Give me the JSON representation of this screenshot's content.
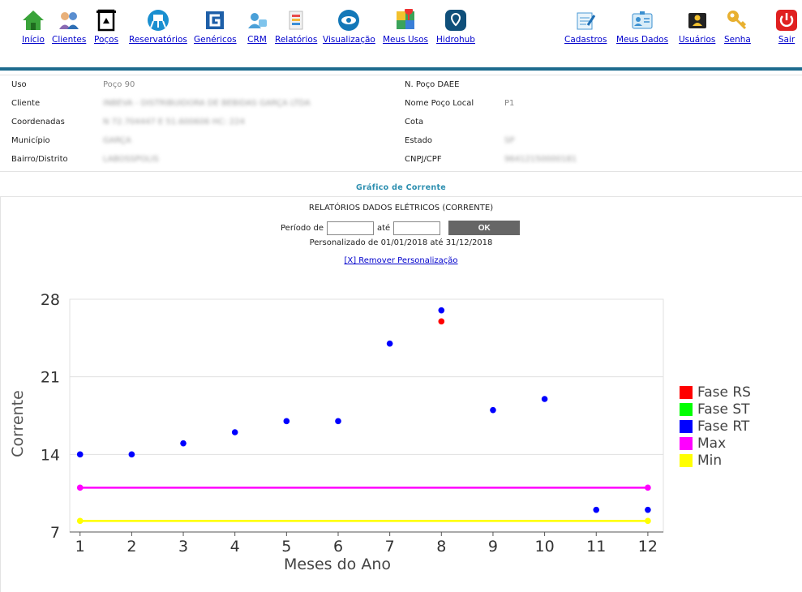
{
  "nav": {
    "left": [
      {
        "label": "Início",
        "icon": "home-icon"
      },
      {
        "label": "Clientes",
        "icon": "clients-icon"
      },
      {
        "label": "Poços",
        "icon": "well-icon"
      },
      {
        "label": "Reservatórios",
        "icon": "reservoir-icon"
      },
      {
        "label": "Genéricos",
        "icon": "generic-icon"
      },
      {
        "label": "CRM",
        "icon": "crm-icon"
      },
      {
        "label": "Relatórios",
        "icon": "reports-icon"
      },
      {
        "label": "Visualização",
        "icon": "eye-icon"
      },
      {
        "label": "Meus Usos",
        "icon": "map-icon"
      },
      {
        "label": "Hidrohub",
        "icon": "hidrohub-icon"
      }
    ],
    "right": [
      {
        "label": "Cadastros",
        "icon": "register-icon"
      },
      {
        "label": "Meus Dados",
        "icon": "id-card-icon"
      },
      {
        "label": "Usuários",
        "icon": "users-icon"
      },
      {
        "label": "Senha",
        "icon": "key-icon"
      },
      {
        "label": "Sair",
        "icon": "power-icon"
      }
    ]
  },
  "info": {
    "uso_label": "Uso",
    "uso_value": "Poço 90",
    "cliente_label": "Cliente",
    "cliente_value": "INBEVA - DISTRIBUIDORA DE BEBIDAS GARÇA LTDA",
    "coord_label": "Coordenadas",
    "coord_value": "N 72.704447 E 51.600606 HC: 224",
    "municipio_label": "Município",
    "municipio_value": "GARÇA",
    "bairro_label": "Bairro/Distrito",
    "bairro_value": "LABOSSPOLIS",
    "npoco_label": "N. Poço DAEE",
    "npoco_value": "",
    "nomepoco_label": "Nome Poço Local",
    "nomepoco_value": "P1",
    "cota_label": "Cota",
    "cota_value": "",
    "estado_label": "Estado",
    "estado_value": "SP",
    "cnpj_label": "CNPJ/CPF",
    "cnpj_value": "96412150000181"
  },
  "section_title": "Gráfico de Corrente",
  "report": {
    "title": "RELATÓRIOS DADOS ELÉTRICOS (CORRENTE)",
    "period_label": "Período de",
    "until_label": "até",
    "from_value": "",
    "to_value": "",
    "ok_label": "OK",
    "custom_text": "Personalizado de 01/01/2018 até 31/12/2018",
    "remove_link": "[X] Remover Personalização"
  },
  "colors": {
    "nav_rule": "#1d6b8e",
    "link": "#0000cc",
    "section_title": "#2d8fb0"
  },
  "chart_data": {
    "type": "scatter",
    "xlabel": "Meses do Ano",
    "ylabel": "Corrente",
    "x_ticks": [
      1,
      2,
      3,
      4,
      5,
      6,
      7,
      8,
      9,
      10,
      11,
      12
    ],
    "y_ticks": [
      7,
      14,
      21,
      28
    ],
    "xlim": [
      0.8,
      12.3
    ],
    "ylim": [
      7,
      28
    ],
    "grid": "horizontal",
    "legend_position": "right",
    "series": [
      {
        "name": "Fase RS",
        "color": "#ff0000",
        "mode": "markers",
        "points": [
          [
            8,
            26
          ]
        ]
      },
      {
        "name": "Fase ST",
        "color": "#00ff00",
        "mode": "markers",
        "points": []
      },
      {
        "name": "Fase RT",
        "color": "#0000ff",
        "mode": "markers",
        "points": [
          [
            1,
            14
          ],
          [
            2,
            14
          ],
          [
            3,
            15
          ],
          [
            4,
            16
          ],
          [
            5,
            17
          ],
          [
            6,
            17
          ],
          [
            7,
            24
          ],
          [
            8,
            27
          ],
          [
            9,
            18
          ],
          [
            10,
            19
          ],
          [
            11,
            9
          ],
          [
            12,
            9
          ]
        ]
      },
      {
        "name": "Max",
        "color": "#ff00ff",
        "mode": "line",
        "points": [
          [
            1,
            11
          ],
          [
            12,
            11
          ]
        ]
      },
      {
        "name": "Min",
        "color": "#ffff00",
        "mode": "line",
        "points": [
          [
            1,
            8
          ],
          [
            12,
            8
          ]
        ]
      }
    ]
  }
}
